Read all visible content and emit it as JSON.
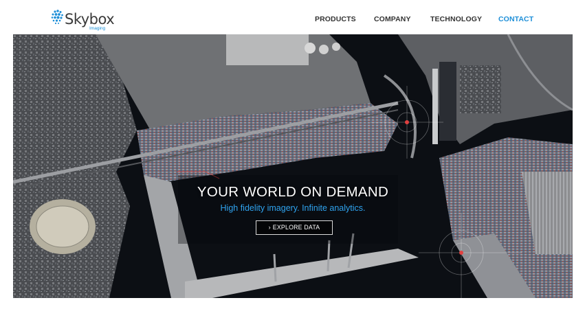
{
  "brand": {
    "name": "Skybox",
    "tagline": "Imaging",
    "accent": "#1e8fd8"
  },
  "nav": {
    "items": [
      {
        "label": "PRODUCTS"
      },
      {
        "label": "COMPANY"
      },
      {
        "label": "TECHNOLOGY"
      },
      {
        "label": "CONTACT",
        "active": true
      }
    ]
  },
  "hero": {
    "title": "YOUR WORLD ON DEMAND",
    "subtitle": "High fidelity imagery. Infinite analytics.",
    "cta": {
      "label": "EXPLORE DATA",
      "icon": "chevron-right-icon"
    },
    "background": "satellite-port-image",
    "title_color": "#ffffff",
    "subtitle_color": "#2fa3ef"
  }
}
